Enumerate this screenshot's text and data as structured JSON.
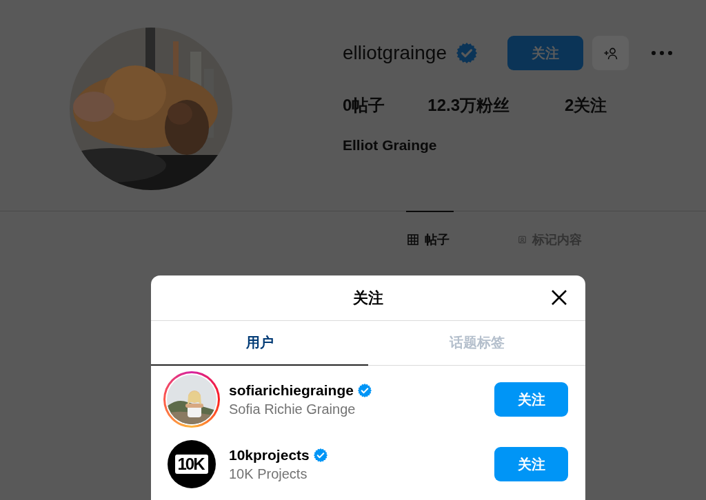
{
  "profile": {
    "username": "elliotgrainge",
    "verified": true,
    "follow_button": "关注",
    "stats": [
      "0帖子",
      "12.3万粉丝",
      "2关注"
    ],
    "full_name": "Elliot Grainge"
  },
  "profile_tabs": [
    {
      "label": "帖子",
      "selected": true,
      "kind": "grid"
    },
    {
      "label": "标记内容",
      "selected": false,
      "kind": "tag"
    }
  ],
  "dialog": {
    "title": "关注",
    "tabs": [
      {
        "label": "用户",
        "selected": true
      },
      {
        "label": "话题标签",
        "selected": false
      }
    ],
    "users": [
      {
        "username": "sofiarichiegrainge",
        "verified": true,
        "full_name": "Sofia Richie Grainge",
        "avatar": {
          "kind": "picture",
          "story_ring": true
        },
        "button": "关注"
      },
      {
        "username": "10kprojects",
        "verified": true,
        "full_name": "10K Projects",
        "avatar": {
          "kind": "logo",
          "text": "10K",
          "story_ring": false
        },
        "button": "关注"
      }
    ]
  }
}
